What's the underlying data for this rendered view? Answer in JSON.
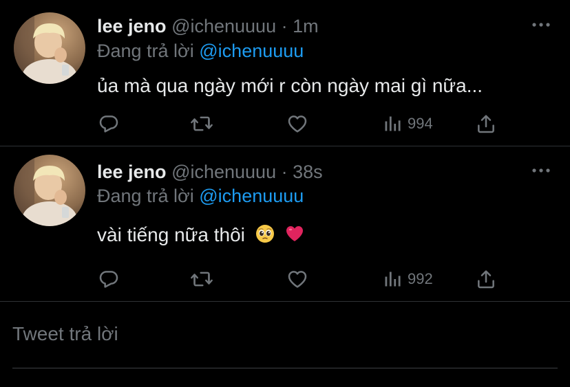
{
  "colors": {
    "background": "#000000",
    "text_primary": "#e7e9ea",
    "text_secondary": "#71767b",
    "mention": "#1d9bf0",
    "divider": "#2f3336"
  },
  "tweets": [
    {
      "display_name": "lee jeno",
      "handle": "@ichenuuuu",
      "separator": "·",
      "time": "1m",
      "replying_prefix": "Đang trả lời ",
      "replying_to": "@ichenuuuu",
      "text": "ủa mà qua ngày mới r còn ngày mai gì nữa...",
      "views": "994",
      "emojis": [],
      "icons": [
        "avatar",
        "more-icon",
        "reply-icon",
        "retweet-icon",
        "like-icon",
        "views-icon",
        "share-icon"
      ]
    },
    {
      "display_name": "lee jeno",
      "handle": "@ichenuuuu",
      "separator": "·",
      "time": "38s",
      "replying_prefix": "Đang trả lời ",
      "replying_to": "@ichenuuuu",
      "text": "vài tiếng nữa thôi",
      "views": "992",
      "emojis": [
        "pleading-face",
        "red-heart"
      ],
      "icons": [
        "avatar",
        "more-icon",
        "reply-icon",
        "retweet-icon",
        "like-icon",
        "views-icon",
        "share-icon"
      ]
    }
  ],
  "compose": {
    "placeholder": "Tweet trả lời"
  }
}
